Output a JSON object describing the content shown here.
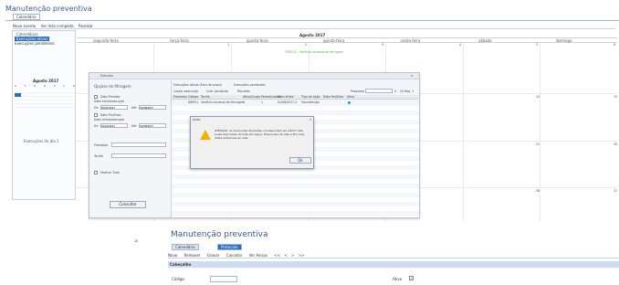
{
  "window": {
    "title": "Manutenção preventiva"
  },
  "top_tabs": [
    "Calendário"
  ],
  "toolbar": {
    "items": [
      "Novo evento",
      "Ver lista completa",
      "Realizar"
    ]
  },
  "sidebar": {
    "calendars_label": "Calendários",
    "calendar_items": [
      "Execuções ativas",
      "Execuções pendentes"
    ],
    "mini_month": "Agosto 2017",
    "mini_dow": [
      "S",
      "T",
      "Q",
      "Q",
      "S",
      "S",
      "D"
    ],
    "day_events_label": "Execuções do dia 1"
  },
  "calendar": {
    "month_title": "Agosto 2017",
    "weekdays": [
      "segunda-feira",
      "terça-feira",
      "quarta-feira",
      "quinta-feira",
      "sexta-feira",
      "sábado",
      "domingo"
    ],
    "event_text": "TSE0.01 - Verificar excesso de ferrugem",
    "day_numbers": [
      "1",
      "2",
      "3",
      "4",
      "5",
      "6",
      "13",
      "20",
      "27",
      "14",
      "21",
      "28"
    ]
  },
  "dialog": {
    "title": "Executar",
    "left_section": "Opções de filtragem",
    "check1": "Data Prevista",
    "filter_label1": "Data início/execução",
    "from_label": "De",
    "to_label": "Até",
    "date_from": "01/01/2017",
    "date_to": "31/08/2017",
    "check2": "Data Fim/Exec",
    "filter_label2": "Data início/execução",
    "prestador_label": "Prestador",
    "tarefa_label": "Tarefa",
    "show_all": "Mostrar Tudo",
    "consult_button": "Consultar",
    "tabs": [
      "Execuções ativas (Fora de prazo)",
      "Execuções pendentes"
    ],
    "actions": [
      "Lançar execução",
      "Criar pendente",
      "Recolher"
    ],
    "search_label": "Pesquisar",
    "per_page": "10 Reg. 1",
    "columns": [
      "Prestador",
      "Código",
      "Tarefa",
      "Ativo/Grupo",
      "Periodicidade",
      "Data limite",
      "Tipo de Ação",
      "Data fim/Exec",
      "Ativo"
    ],
    "row": [
      "",
      "DBP.01",
      "Verificar excesso de ferrugem",
      "1",
      "1",
      "01/08/2017 0",
      "Manutenção",
      "",
      ""
    ]
  },
  "alert": {
    "title": "Aviso",
    "message": "ATENÇÃO: as execuções atrasadas correspondem ao último mês (suas execuções do mês em vigor). Execuções do mês e fins mas datas anteriores ao mês",
    "ok_label": "Ok"
  },
  "bottom_panel": {
    "title": "Manutenção preventiva",
    "tabs": [
      "Calendário",
      "Protocolo"
    ],
    "toolbar": [
      "Novo",
      "Remover",
      "Gravar",
      "Cancelar",
      "Ver Avisos"
    ],
    "nav": [
      "<<",
      "<",
      ">",
      ">>"
    ],
    "section": "Cabeçalho",
    "field_label": "Código",
    "active_label": "Ativo",
    "day_number": "28"
  }
}
